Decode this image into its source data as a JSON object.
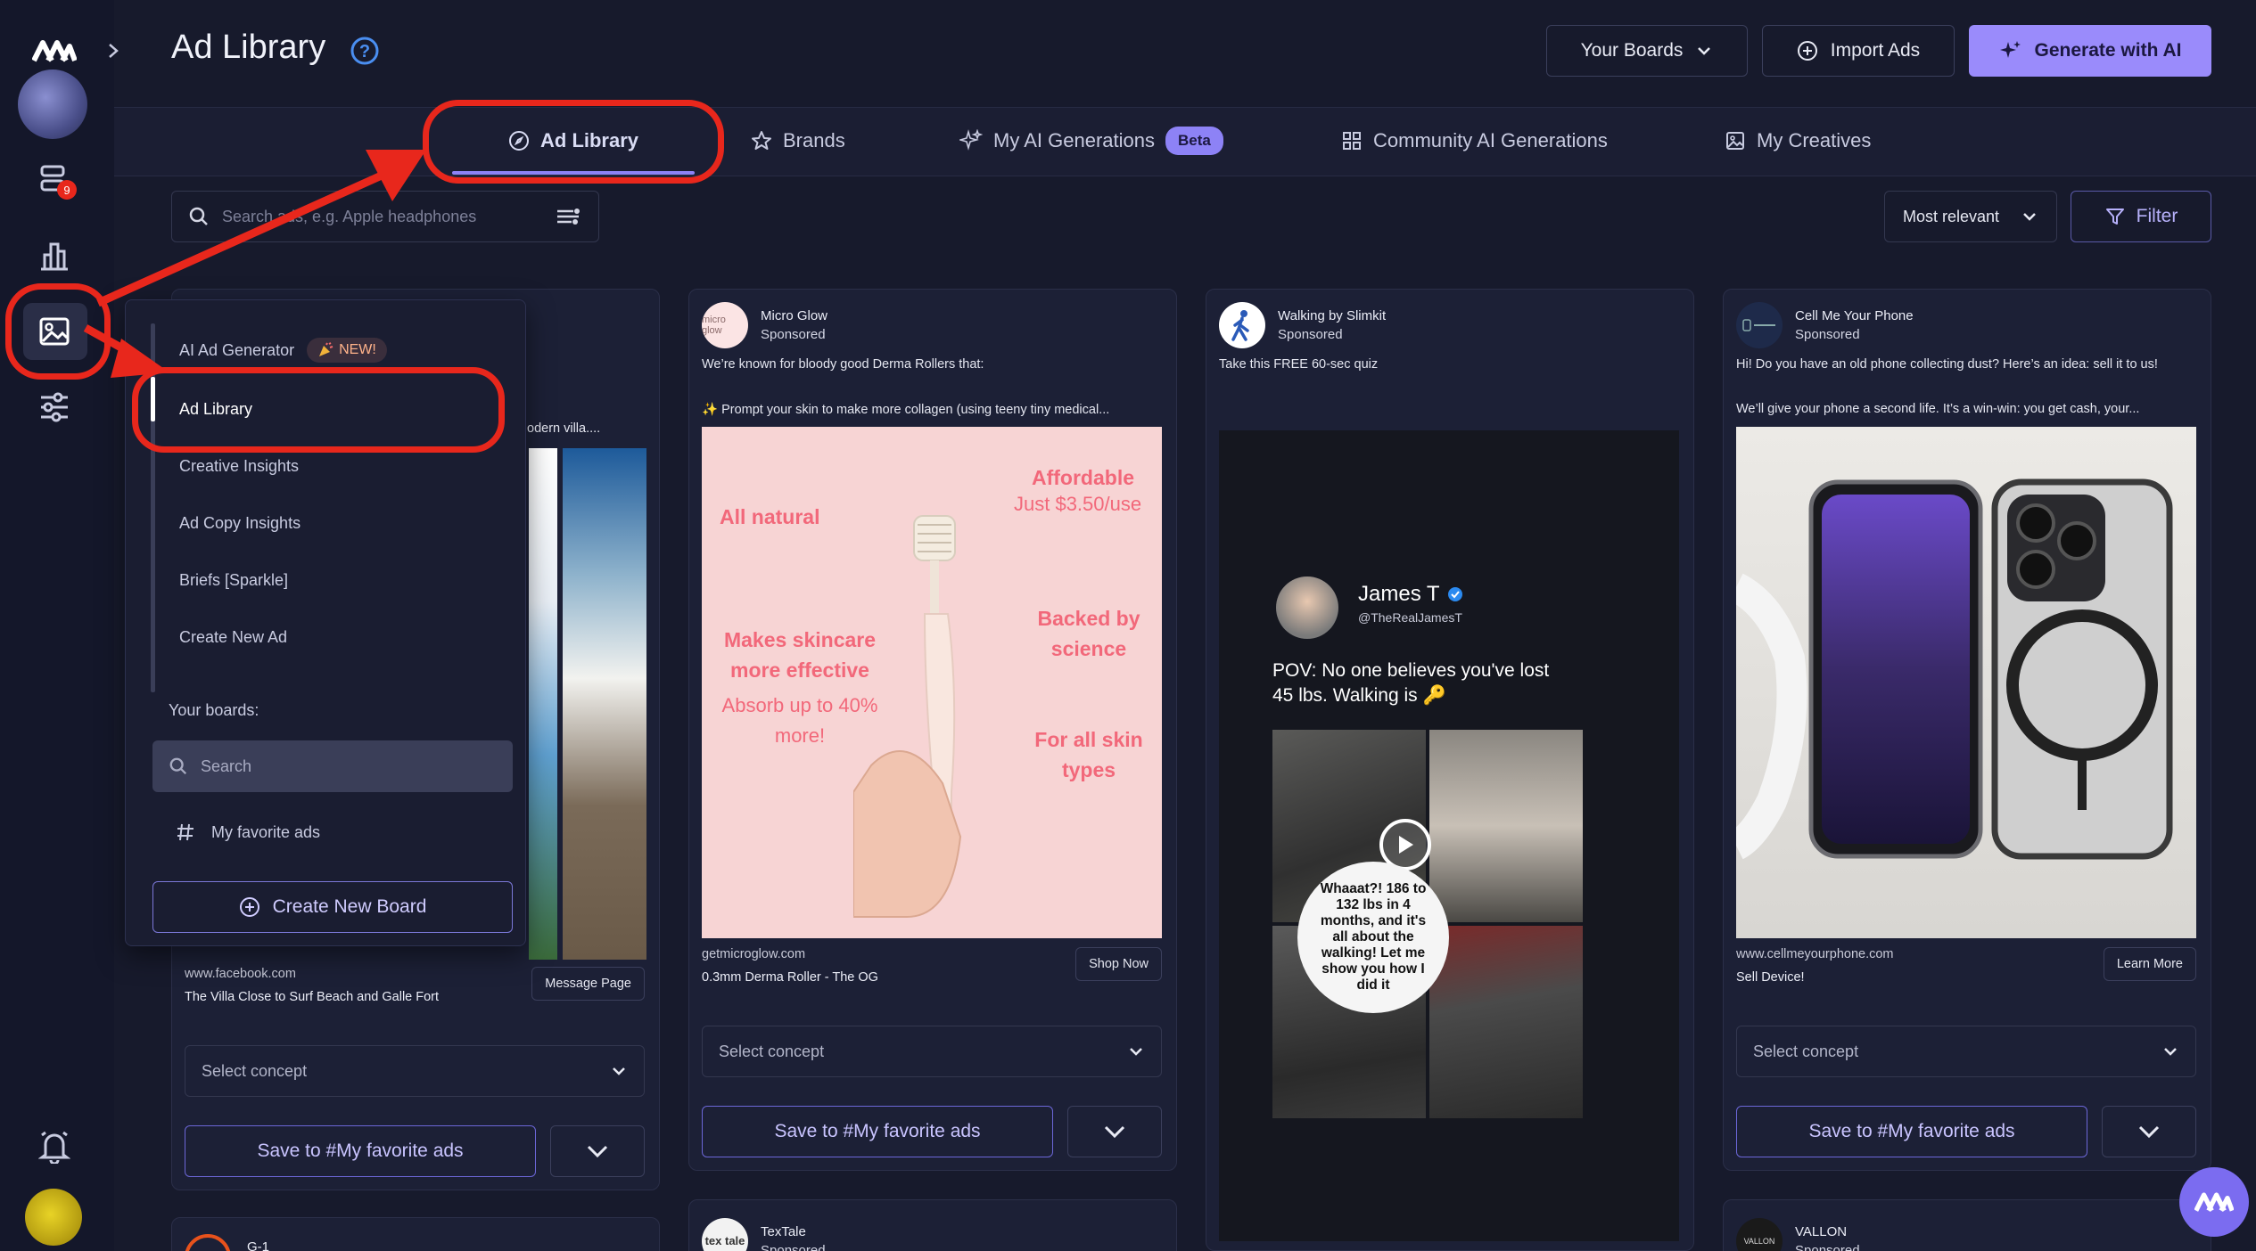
{
  "header": {
    "title": "Ad Library",
    "your_boards": "Your Boards",
    "import_ads": "Import Ads",
    "generate_ai": "Generate with AI"
  },
  "rail": {
    "notification_count": "9"
  },
  "tabs": [
    {
      "label": "Ad Library"
    },
    {
      "label": "Brands"
    },
    {
      "label": "My AI Generations",
      "badge": "Beta"
    },
    {
      "label": "Community AI Generations"
    },
    {
      "label": "My Creatives"
    }
  ],
  "search": {
    "placeholder": "Search ads, e.g. Apple headphones"
  },
  "sort": {
    "value": "Most relevant"
  },
  "filter": {
    "label": "Filter"
  },
  "menu": {
    "ai_generator": "AI Ad Generator",
    "new_badge": "NEW!",
    "items": [
      "Ad Library",
      "Creative Insights",
      "Ad Copy Insights",
      "Briefs [Sparkle]",
      "Create New Ad"
    ],
    "boards_heading": "Your boards:",
    "search_placeholder": "Search",
    "board": "My favorite ads",
    "create_board": "Create New Board"
  },
  "cards": [
    {
      "partial_text": "odern villa....",
      "cta_url": "www.facebook.com",
      "cta_title": "The Villa Close to Surf Beach and Galle Fort",
      "cta_button": "Message Page",
      "select": "Select concept",
      "save": "Save to #My favorite ads"
    },
    {
      "brand": "Micro Glow",
      "logo_text": "micro glow",
      "sponsored": "Sponsored",
      "text1": "We’re known for bloody good Derma Rollers that:",
      "text2": "✨ Prompt your skin to make more collagen (using teeny tiny medical...",
      "creative": {
        "all_natural": "All natural",
        "affordable": "Affordable",
        "price": "Just $3.50/use",
        "makes": "Makes skincare more effective",
        "absorb": "Absorb up to 40% more!",
        "backed": "Backed by science",
        "skin": "For all skin types"
      },
      "cta_url": "getmicroglow.com",
      "cta_title": "0.3mm Derma Roller - The OG",
      "cta_button": "Shop Now",
      "select": "Select concept",
      "save": "Save to #My favorite ads"
    },
    {
      "brand": "Walking by Slimkit",
      "sponsored": "Sponsored",
      "text1": "Take this FREE 60-sec quiz",
      "creative": {
        "name": "James T",
        "handle": "@TheRealJamesT",
        "pov": "POV: No one believes you've lost 45 lbs. Walking is 🔑",
        "bubble": "Whaaat?! 186 to 132 lbs in 4 months, and it's all about the walking! Let me show you how I did it"
      }
    },
    {
      "brand": "Cell Me Your Phone",
      "sponsored": "Sponsored",
      "text1": "Hi! Do you have an old phone collecting dust? Here’s an idea: sell it to us!",
      "text2": "We’ll give your phone a second life. It’s a win-win: you get cash, your...",
      "cta_url": "www.cellmeyourphone.com",
      "cta_title": "Sell Device!",
      "cta_button": "Learn More",
      "select": "Select concept",
      "save": "Save to #My favorite ads"
    }
  ],
  "bottom_cards": [
    {
      "brand": "G-1"
    },
    {
      "brand": "TexTale",
      "sponsored": "Sponsored",
      "logo_text": "tex tale"
    },
    {
      "brand": "VALLON",
      "sponsored": "Sponsored",
      "logo_text": "VALLON"
    }
  ],
  "colors": {
    "accent": "#8d82f6",
    "annotation": "#e8271c",
    "background": "#171a2c"
  }
}
